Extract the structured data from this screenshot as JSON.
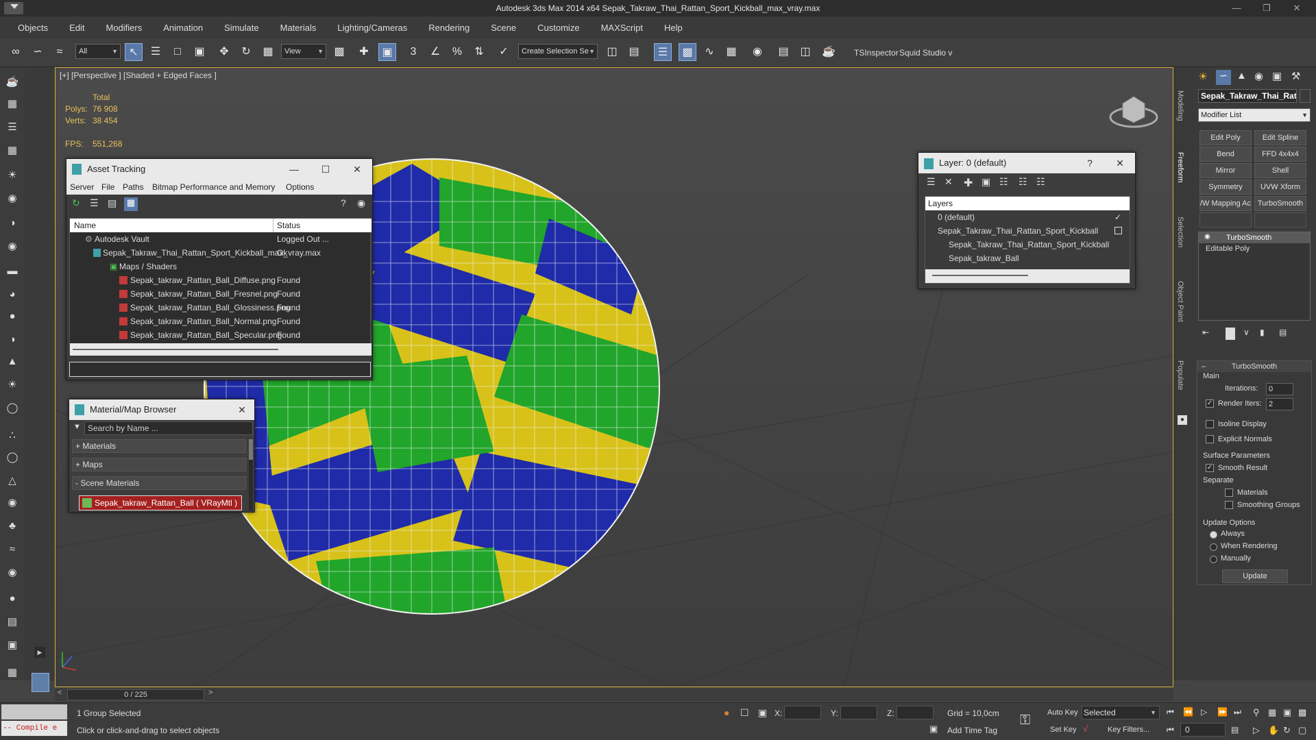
{
  "window": {
    "title": "Autodesk 3ds Max  2014 x64    Sepak_Takraw_Thai_Rattan_Sport_Kickball_max_vray.max"
  },
  "menu": [
    "Objects",
    "Edit",
    "Modifiers",
    "Animation",
    "Simulate",
    "Materials",
    "Lighting/Cameras",
    "Rendering",
    "Scene",
    "Customize",
    "MAXScript",
    "Help"
  ],
  "toolbar": {
    "filter_value": "All",
    "view_value": "View",
    "selection_set_placeholder": "Create Selection Se",
    "ts_inspector": "TSInspector",
    "squid": "Squid Studio v"
  },
  "viewport": {
    "label": "[+] [Perspective ] [Shaded + Edged Faces ]",
    "stats_header": "Total",
    "polys_label": "Polys:",
    "polys_value": "76 908",
    "verts_label": "Verts:",
    "verts_value": "38 454",
    "fps_label": "FPS:",
    "fps_value": "551,268"
  },
  "asset_tracking": {
    "title": "Asset Tracking",
    "menu": [
      "Server",
      "File",
      "Paths",
      "Bitmap Performance and Memory",
      "Options"
    ],
    "col_name": "Name",
    "col_status": "Status",
    "rows": [
      {
        "name": "Autodesk Vault",
        "status": "Logged Out ..."
      },
      {
        "name": "Sepak_Takraw_Thai_Rattan_Sport_Kickball_max_vray.max",
        "status": "Ok"
      },
      {
        "name": "Maps / Shaders",
        "status": ""
      },
      {
        "name": "Sepak_takraw_Rattan_Ball_Diffuse.png",
        "status": "Found"
      },
      {
        "name": "Sepak_takraw_Rattan_Ball_Fresnel.png",
        "status": "Found"
      },
      {
        "name": "Sepak_takraw_Rattan_Ball_Glossiness.png",
        "status": "Found"
      },
      {
        "name": "Sepak_takraw_Rattan_Ball_Normal.png",
        "status": "Found"
      },
      {
        "name": "Sepak_takraw_Rattan_Ball_Specular.png",
        "status": "Found"
      }
    ]
  },
  "material_browser": {
    "title": "Material/Map Browser",
    "search_placeholder": "Search by Name ...",
    "materials": "+ Materials",
    "maps": "+ Maps",
    "scene_materials": "- Scene Materials",
    "item": "Sepak_takraw_Rattan_Ball  ( VRayMtl )"
  },
  "layer_window": {
    "title": "Layer: 0 (default)",
    "help": "?",
    "header": "Layers",
    "rows": [
      {
        "name": "0 (default)"
      },
      {
        "name": "Sepak_Takraw_Thai_Rattan_Sport_Kickball"
      },
      {
        "name": "Sepak_Takraw_Thai_Rattan_Sport_Kickball"
      },
      {
        "name": "Sepak_takraw_Ball"
      }
    ]
  },
  "side_tabs": [
    "Modeling",
    "Freeform",
    "Selection",
    "Object Paint",
    "Populate"
  ],
  "command_panel": {
    "object_name": "Sepak_Takraw_Thai_Rat",
    "modifier_list": "Modifier List",
    "buttons": [
      "Edit Poly",
      "Edit Spline",
      "Bend",
      "FFD 4x4x4",
      "Mirror",
      "Shell",
      "Symmetry",
      "UVW Xform",
      "/W Mapping Ac",
      "TurboSmooth"
    ],
    "stack": [
      "TurboSmooth",
      "Editable Poly"
    ],
    "rollout_title": "TurboSmooth",
    "main": "Main",
    "iterations_label": "Iterations:",
    "iterations_value": "0",
    "render_iters_label": "Render Iters:",
    "render_iters_value": "2",
    "isoline": "Isoline Display",
    "explicit_normals": "Explicit Normals",
    "surface_params": "Surface Parameters",
    "smooth_result": "Smooth Result",
    "separate": "Separate",
    "materials": "Materials",
    "smoothing_groups": "Smoothing Groups",
    "update_options": "Update Options",
    "always": "Always",
    "when_rendering": "When Rendering",
    "manually": "Manually",
    "update_btn": "Update"
  },
  "timeline": {
    "frame": "0 / 225"
  },
  "status": {
    "maxscript": "-- Compile e",
    "selected": "1 Group Selected",
    "prompt": "Click or click-and-drag to select objects",
    "x_label": "X:",
    "y_label": "Y:",
    "z_label": "Z:",
    "grid": "Grid = 10,0cm",
    "add_time_tag": "Add Time Tag",
    "auto_key": "Auto Key",
    "set_key": "Set Key",
    "selected_dd": "Selected",
    "key_filters": "Key Filters...",
    "frame_value": "0"
  }
}
